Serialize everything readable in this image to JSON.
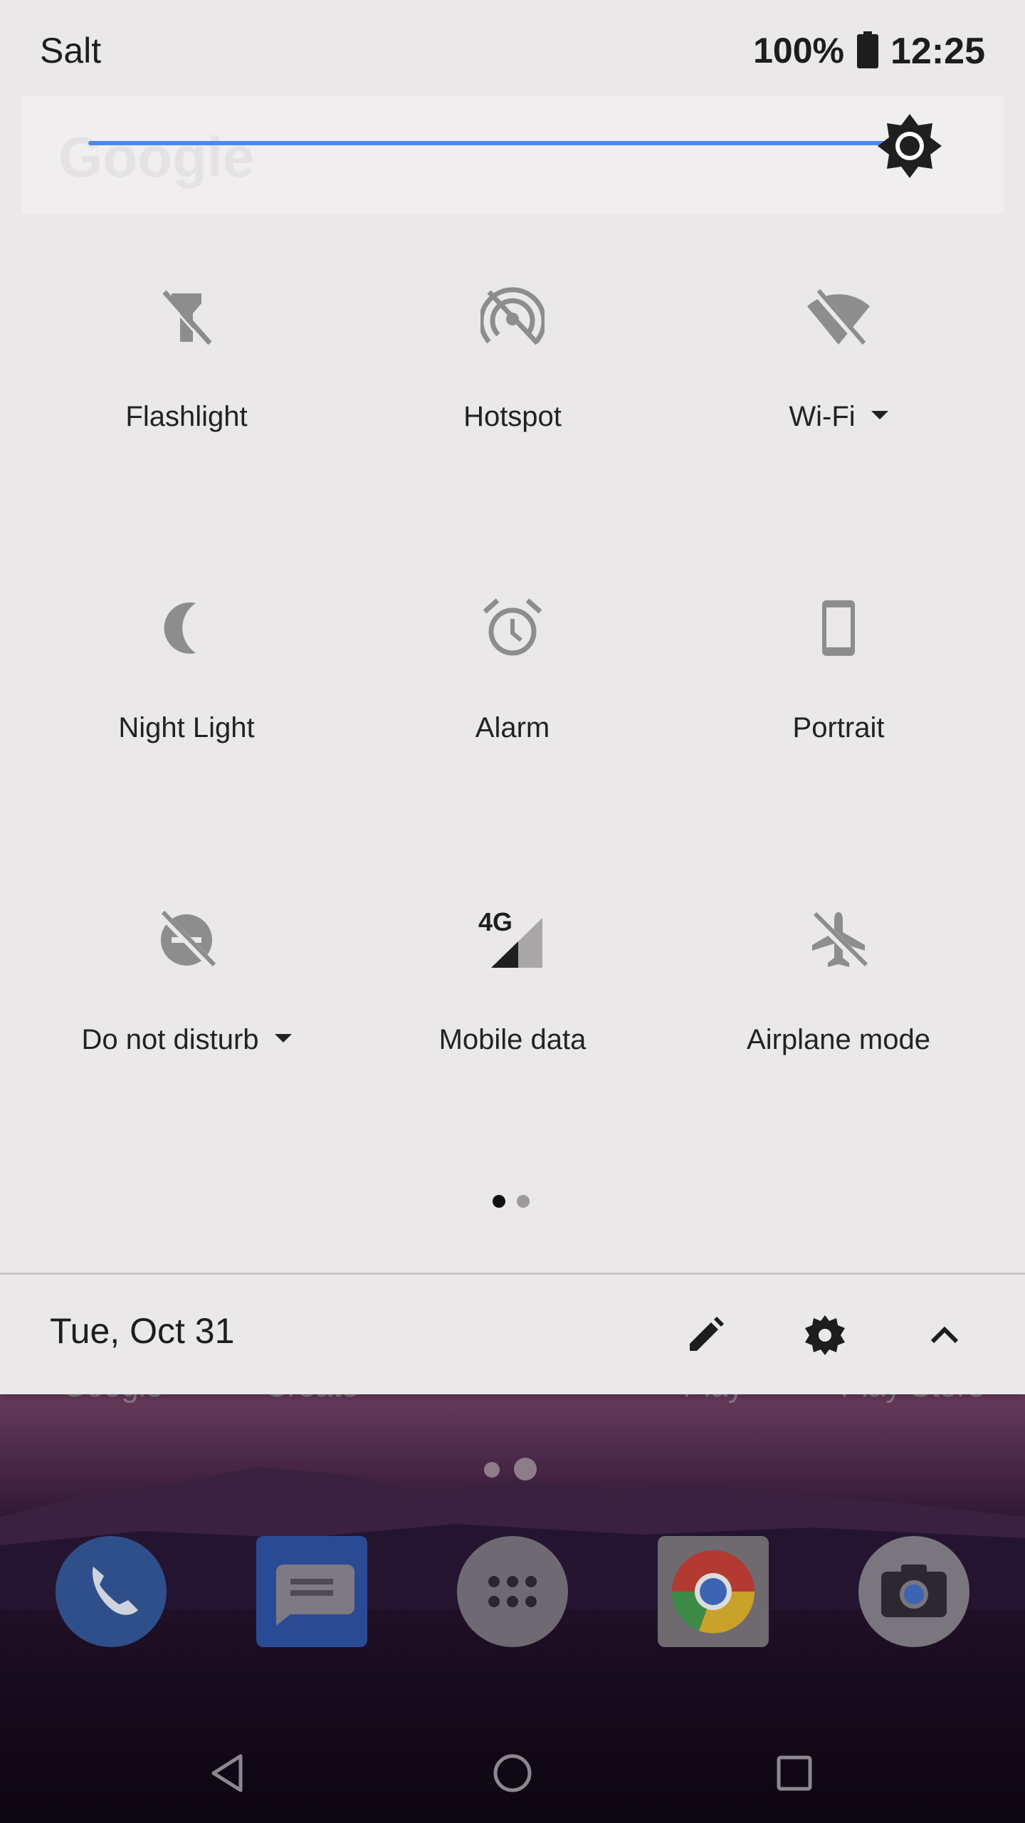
{
  "status_bar": {
    "carrier": "Salt",
    "battery_percent": "100%",
    "time": "12:25"
  },
  "brightness": {
    "level": 0.97,
    "ghost_text": "Google",
    "accent": "#4a89e6"
  },
  "tiles": [
    {
      "label": "Flashlight",
      "icon": "flashlight-off-icon",
      "has_menu": false
    },
    {
      "label": "Hotspot",
      "icon": "hotspot-off-icon",
      "has_menu": false
    },
    {
      "label": "Wi-Fi",
      "icon": "wifi-off-icon",
      "has_menu": true
    },
    {
      "label": "Night Light",
      "icon": "moon-icon",
      "has_menu": false
    },
    {
      "label": "Alarm",
      "icon": "alarm-clock-icon",
      "has_menu": false
    },
    {
      "label": "Portrait",
      "icon": "phone-portrait-icon",
      "has_menu": false
    },
    {
      "label": "Do not disturb",
      "icon": "do-not-disturb-off-icon",
      "has_menu": true
    },
    {
      "label": "Mobile data",
      "icon": "signal-4g-icon",
      "has_menu": false,
      "badge": "4G"
    },
    {
      "label": "Airplane mode",
      "icon": "airplane-off-icon",
      "has_menu": false
    }
  ],
  "qs_pages": {
    "current": 1,
    "total": 2
  },
  "footer": {
    "date": "Tue, Oct 31",
    "edit_icon": "pencil-icon",
    "settings_icon": "gear-icon",
    "collapse_icon": "chevron-up-icon"
  },
  "launcher": {
    "apps": [
      {
        "label": "Google"
      },
      {
        "label": "Create"
      },
      {
        "label": "Play"
      },
      {
        "label": "Play Store"
      }
    ],
    "dock": [
      "phone-icon",
      "messages-icon",
      "app-drawer-icon",
      "chrome-icon",
      "camera-icon"
    ]
  },
  "navigation": [
    "back-icon",
    "home-icon",
    "recents-icon"
  ]
}
